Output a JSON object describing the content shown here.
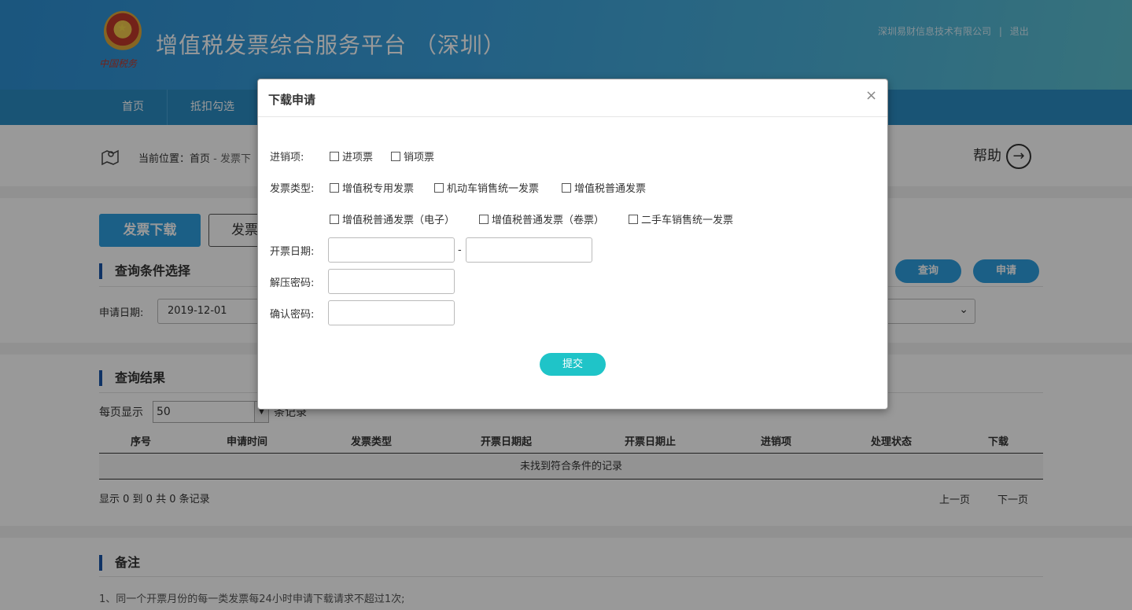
{
  "header": {
    "logo_text": "中国税务",
    "title": "增值税发票综合服务平台 （深圳）",
    "company": "深圳易财信息技术有限公司",
    "separator": "|",
    "logout": "退出"
  },
  "nav": {
    "items": [
      {
        "label": "首页"
      },
      {
        "label": "抵扣勾选"
      }
    ]
  },
  "breadcrumb": {
    "prefix": "当前位置：",
    "home": "首页",
    "sep": " - ",
    "current": "发票下"
  },
  "help": {
    "label": "帮助",
    "icon": "arrow-right-circle-icon",
    "glyph": "→"
  },
  "tabs": {
    "active": "发票下载",
    "inactive": "发票"
  },
  "query": {
    "title": "查询条件选择",
    "date_label": "申请日期:",
    "date_value": "2019-12-01",
    "search_button": "查询",
    "apply_button": "申请",
    "select_chevron": "⌄"
  },
  "results": {
    "title": "查询结果",
    "page_size_prefix": "每页显示",
    "page_size_value": "50",
    "page_size_suffix": "条记录",
    "columns": [
      "序号",
      "申请时间",
      "发票类型",
      "开票日期起",
      "开票日期止",
      "进销项",
      "处理状态",
      "下载"
    ],
    "empty_message": "未找到符合条件的记录",
    "summary": "显示 0 到 0 共 0 条记录",
    "prev": "上一页",
    "next": "下一页"
  },
  "notes": {
    "title": "备注",
    "items": [
      "1、同一个开票月份的每一类发票每24小时申请下载请求不超过1次;"
    ]
  },
  "modal": {
    "title": "下载申请",
    "close": "×",
    "direction_label": "进销项:",
    "direction_options": [
      "进项票",
      "销项票"
    ],
    "type_label": "发票类型:",
    "type_options": [
      "增值税专用发票",
      "机动车销售统一发票",
      "增值税普通发票",
      "增值税普通发票（电子）",
      "增值税普通发票（卷票）",
      "二手车销售统一发票"
    ],
    "date_label": "开票日期:",
    "date_sep": "-",
    "password_label": "解压密码:",
    "confirm_label": "确认密码:",
    "submit": "提交"
  },
  "colors": {
    "primary": "#2d9ee0",
    "nav": "#2b8cc4",
    "submit": "#1fc4c8",
    "section_bar": "#1a56a8"
  }
}
